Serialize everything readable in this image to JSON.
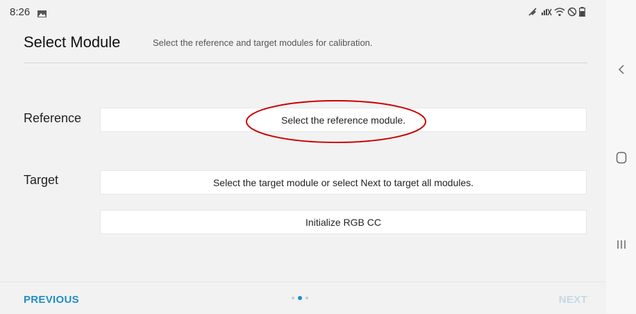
{
  "status_bar": {
    "time": "8:26",
    "icons": [
      "image-icon",
      "mute-icon",
      "signal-icon",
      "wifi-icon",
      "dnd-icon",
      "battery-icon"
    ]
  },
  "header": {
    "title": "Select Module",
    "subtitle": "Select the reference and target modules for calibration."
  },
  "reference": {
    "label": "Reference",
    "field_text": "Select the reference module."
  },
  "target": {
    "label": "Target",
    "field_text": "Select the target module or select Next to target all modules."
  },
  "init_button": {
    "label": "Initialize RGB CC"
  },
  "footer": {
    "previous_label": "PREVIOUS",
    "next_label": "NEXT",
    "page_dots": {
      "count": 3,
      "active_index": 1
    }
  },
  "navbar": {
    "icons": [
      "back-icon",
      "home-icon",
      "recents-icon"
    ]
  },
  "colors": {
    "accent": "#1e8ec6",
    "next_disabled": "#c5d9e5",
    "highlight_oval": "#cc0000",
    "background": "#f2f2f2"
  }
}
